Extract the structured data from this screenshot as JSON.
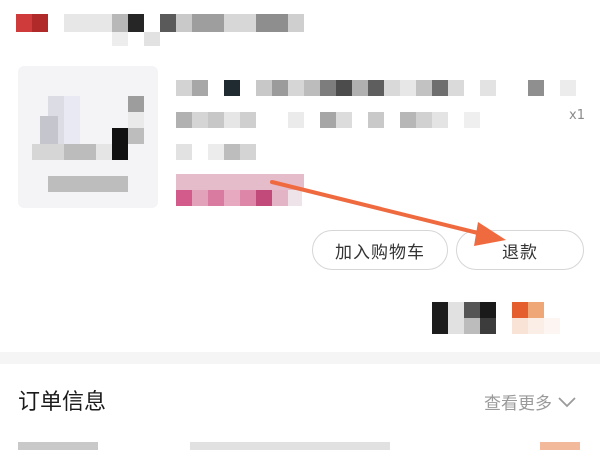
{
  "product": {
    "quantity": "x1"
  },
  "actions": {
    "add_to_cart_label": "加入购物车",
    "refund_label": "退款"
  },
  "order_info": {
    "title": "订单信息",
    "more_label": "查看更多"
  },
  "colors": {
    "annotation_arrow": "#f06a40",
    "button_border": "#d6d6d6",
    "muted_text": "#9a9a9a"
  },
  "icons": {
    "more": "chevron-down-icon",
    "annotation": "arrow-annotation-icon"
  }
}
